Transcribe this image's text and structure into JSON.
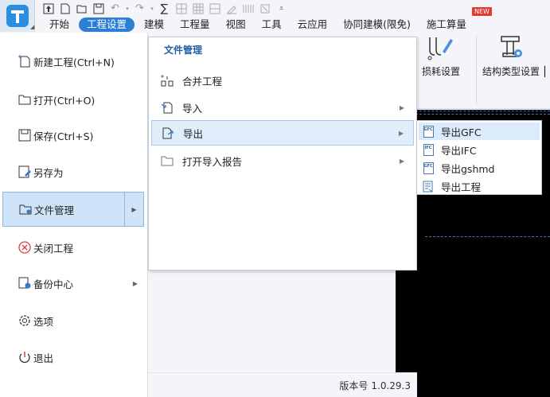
{
  "quick_access": {
    "icons": [
      "up-arrow-icon",
      "new-file-icon",
      "open-folder-icon",
      "save-icon",
      "undo-icon",
      "redo-icon",
      "sum-icon",
      "grid-a-icon",
      "grid-b-icon",
      "edit-icon",
      "table-icon",
      "clear-icon",
      "dropdown-icon"
    ]
  },
  "tabs": [
    {
      "label": "开始"
    },
    {
      "label": "工程设置",
      "active": true
    },
    {
      "label": "建模"
    },
    {
      "label": "工程量"
    },
    {
      "label": "视图"
    },
    {
      "label": "工具"
    },
    {
      "label": "云应用"
    },
    {
      "label": "协同建模(限免)"
    },
    {
      "label": "施工算量"
    }
  ],
  "new_badge": "NEW",
  "ribbon": {
    "loss_settings": "损耗设置",
    "structure_type_settings": "结构类型设置"
  },
  "file_menu": {
    "items": [
      {
        "label": "新建工程(Ctrl+N)",
        "icon": "new-project-icon"
      },
      {
        "label": "打开(Ctrl+O)",
        "icon": "open-folder-icon"
      },
      {
        "label": "保存(Ctrl+S)",
        "icon": "save-icon"
      },
      {
        "label": "另存为",
        "icon": "save-as-icon"
      },
      {
        "label": "文件管理",
        "icon": "file-manage-icon",
        "active": true,
        "has_submenu": true
      },
      {
        "label": "关闭工程",
        "icon": "close-circle-icon"
      },
      {
        "label": "备份中心",
        "icon": "backup-icon",
        "has_submenu": true
      },
      {
        "label": "选项",
        "icon": "gear-icon"
      },
      {
        "label": "退出",
        "icon": "power-icon"
      }
    ]
  },
  "submenu": {
    "title": "文件管理",
    "items": [
      {
        "label": "合并工程",
        "icon": "merge-icon"
      },
      {
        "label": "导入",
        "icon": "import-icon",
        "has_submenu": true
      },
      {
        "label": "导出",
        "icon": "export-icon",
        "has_submenu": true,
        "active": true
      },
      {
        "label": "打开导入报告",
        "icon": "folder-icon",
        "has_submenu": true
      }
    ]
  },
  "export_menu": {
    "items": [
      {
        "label": "导出GFC",
        "tag": "GFC",
        "active": true
      },
      {
        "label": "导出IFC",
        "tag": "IFC"
      },
      {
        "label": "导出gshmd",
        "tag": "GFC"
      },
      {
        "label": "导出工程",
        "tag": ""
      }
    ]
  },
  "version": {
    "label": "版本号",
    "value": "1.0.29.3"
  },
  "colors": {
    "accent": "#2c7ed6",
    "badge": "#e03b2e",
    "canvas": "#000000"
  }
}
